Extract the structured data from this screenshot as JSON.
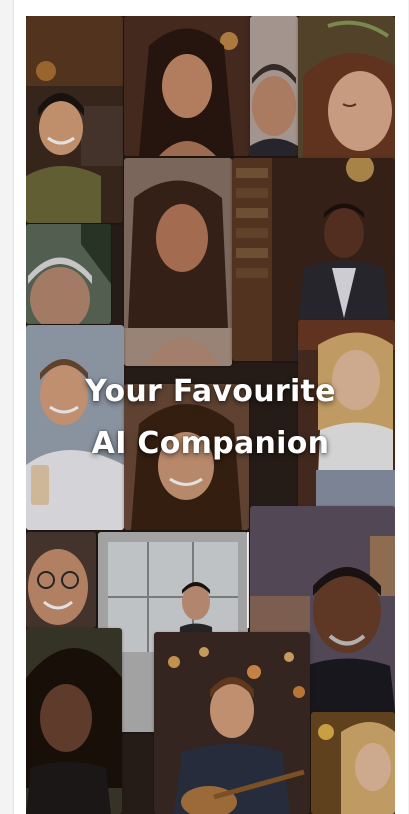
{
  "hero": {
    "headline_line1": "Your Favourite",
    "headline_line2": "AI Companion"
  },
  "colors": {
    "headline_text": "#ffffff",
    "page_background": "#f3f3f3",
    "frame_background": "#ffffff"
  },
  "collage": {
    "tiles": [
      {
        "name": "portrait-tile-young-man-smiling"
      },
      {
        "name": "portrait-tile-woman-long-hair"
      },
      {
        "name": "portrait-tile-middle-aged-man"
      },
      {
        "name": "portrait-tile-woman-eyes-closed"
      },
      {
        "name": "portrait-tile-woman-curly-hair"
      },
      {
        "name": "portrait-tile-man-in-library"
      },
      {
        "name": "portrait-tile-older-man-gray-hair"
      },
      {
        "name": "portrait-tile-young-man-with-drink"
      },
      {
        "name": "portrait-tile-girl-smiling"
      },
      {
        "name": "portrait-tile-blonde-woman-sitting"
      },
      {
        "name": "portrait-tile-man-with-glasses"
      },
      {
        "name": "portrait-tile-woman-in-room"
      },
      {
        "name": "portrait-tile-older-man-city"
      },
      {
        "name": "portrait-tile-woman-curly-dark-hair"
      },
      {
        "name": "portrait-tile-young-man-guitar"
      },
      {
        "name": "portrait-tile-blonde-woman-lights"
      }
    ]
  }
}
